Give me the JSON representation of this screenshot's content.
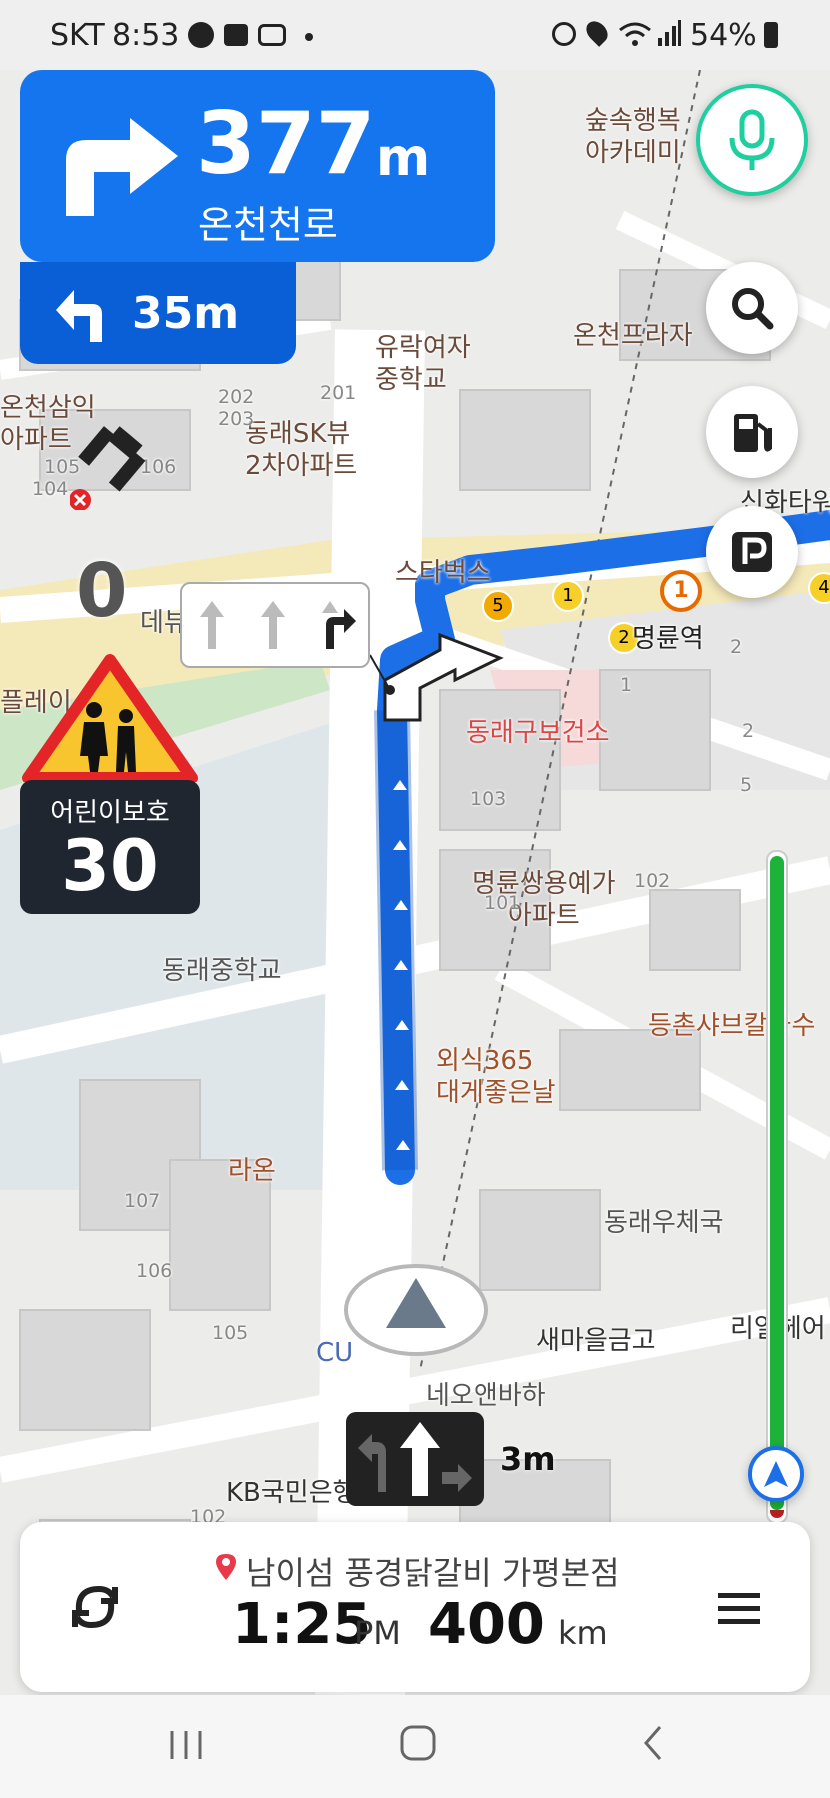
{
  "status_bar": {
    "carrier": "SKT",
    "time": "8:53",
    "battery": "54%",
    "left_icons": [
      "car-icon",
      "gallery-icon",
      "recorder-icon",
      "dot-icon"
    ],
    "right_icons": [
      "alarm-icon",
      "location-icon",
      "wifi-icon",
      "signal-icon",
      "battery-icon"
    ]
  },
  "guidance": {
    "distance": "377",
    "unit": "m",
    "road": "온천천로",
    "turn_icon": "turn-right-arrow-icon",
    "next_distance": "35m",
    "next_icon": "turn-left-arrow-icon"
  },
  "map_labels": {
    "academy": "숲속행복\n아카데미",
    "onchen_plaza": "온천프라자",
    "yurak": "유락여자\n중학교",
    "sk_view": "동래SK뷰\n2차아파트",
    "onchen_apt": "온천삼익\n아파트",
    "starbucks": "스타벅스",
    "myeongnyun_station": "명륜역",
    "health_center": "동래구보건소",
    "myeongnyun_apt": "명륜쌍용예가\n아파트",
    "dongrae_middle": "동래중학교",
    "deungchon": "등촌샤브칼국수",
    "oesik": "외식365\n대게좋은날",
    "raon": "라온",
    "post_office": "동래우체국",
    "saemaeul": "새마을금고",
    "neoanbaha": "네오앤바하",
    "kb_bank": "KB국민은행",
    "cu": "CU",
    "sinhwa": "신화타워",
    "ri_health": "리얼헤어",
    "playground": "플레이스",
    "debyu": "데뷰"
  },
  "subway_badges": [
    "5",
    "1",
    "1",
    "2",
    "4"
  ],
  "building_numbers": [
    "202",
    "203",
    "201",
    "105",
    "104",
    "106",
    "103",
    "101",
    "102",
    "107",
    "106",
    "105",
    "102",
    "1",
    "2",
    "2",
    "5"
  ],
  "speed": {
    "current": "0",
    "zone_label": "어린이보호",
    "limit": "30",
    "zone_icon": "children-crossing-icon"
  },
  "lane_guide": {
    "lanes": [
      "straight-arrow-icon",
      "straight-arrow-icon",
      "straight-right-arrow-icon"
    ]
  },
  "lane_hint": {
    "distance": "3m"
  },
  "map_controls": [
    "microphone-icon",
    "search-icon",
    "gas-station-icon",
    "parking-icon",
    "recenter-compass-icon"
  ],
  "destination": {
    "name": "남이섬 풍경닭갈비 가평본점",
    "arrival_time": "1:25",
    "ampm": "PM",
    "remaining": "400",
    "remaining_unit": "km",
    "pin_icon": "location-pin-icon",
    "left_icon": "reroute-icon",
    "menu_icon": "menu-icon"
  },
  "colors": {
    "guidance_blue": "#1475ee",
    "route_blue": "#1d6fe8",
    "mic_green": "#1fcfa0",
    "progress_green": "#1db23a",
    "warning_red": "#e42528"
  }
}
